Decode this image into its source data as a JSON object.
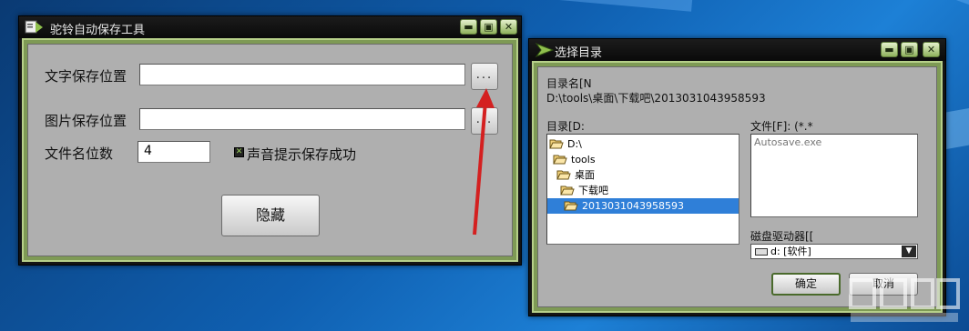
{
  "main_window": {
    "title": "驼铃自动保存工具",
    "text_save_label": "文字保存位置",
    "text_save_value": "",
    "browse_text_label": "...",
    "image_save_label": "图片保存位置",
    "image_save_value": "",
    "browse_image_label": "...",
    "filename_digits_label": "文件名位数",
    "filename_digits_value": "4",
    "sound_checkbox_label": "声音提示保存成功",
    "sound_checked": true,
    "hide_button_label": "隐藏"
  },
  "dialog": {
    "title": "选择目录",
    "dir_name_label": "目录名[N",
    "dir_path": "D:\\tools\\桌面\\下载吧\\2013031043958593",
    "dir_label": "目录[D:",
    "tree": [
      {
        "label": "D:\\",
        "depth": 0,
        "selected": false
      },
      {
        "label": "tools",
        "depth": 1,
        "selected": false
      },
      {
        "label": "桌面",
        "depth": 1,
        "selected": false
      },
      {
        "label": "下载吧",
        "depth": 2,
        "selected": false
      },
      {
        "label": "2013031043958593",
        "depth": 3,
        "selected": true
      }
    ],
    "files_label": "文件[F]: (*.*",
    "files": [
      "Autosave.exe"
    ],
    "drive_label": "磁盘驱动器[[",
    "drive_value": "d: [软件]",
    "ok_label": "确定",
    "cancel_label": "取消"
  },
  "icons": {
    "minimize": "minimize-icon",
    "maximize": "maximize-icon",
    "close": "close-icon",
    "folder": "folder-icon",
    "drive": "drive-icon"
  },
  "colors": {
    "frame_green": "#7e9a55",
    "selection_blue": "#2f7fd8",
    "annotation_red": "#d42020"
  }
}
